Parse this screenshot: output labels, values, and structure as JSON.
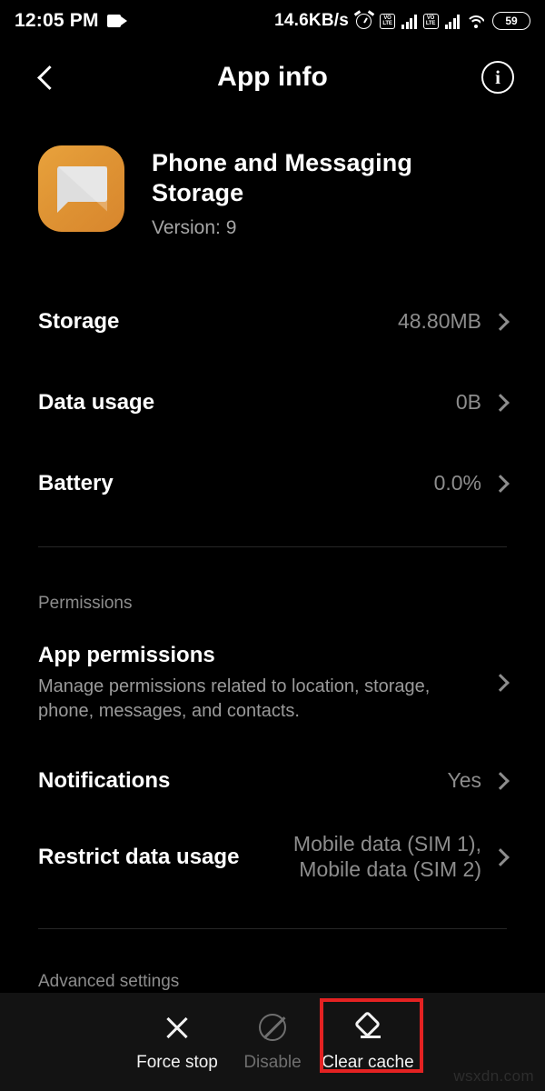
{
  "status_bar": {
    "time": "12:05 PM",
    "camera_icon": "video-camera-icon",
    "network_speed": "14.6KB/s",
    "alarm_icon": "alarm-clock-icon",
    "sim1_volte": "VoLTE",
    "sim2_volte": "VoLTE",
    "wifi_icon": "wifi-icon",
    "battery_level": "59"
  },
  "title_bar": {
    "back_icon": "back-chevron-icon",
    "title": "App info",
    "info_icon": "info-icon",
    "info_glyph": "i"
  },
  "app": {
    "icon": "message-bubble-icon",
    "name": "Phone and Messaging Storage",
    "version": "Version: 9"
  },
  "info_rows": [
    {
      "label": "Storage",
      "value": "48.80MB"
    },
    {
      "label": "Data usage",
      "value": "0B"
    },
    {
      "label": "Battery",
      "value": "0.0%"
    }
  ],
  "permissions_section": {
    "label": "Permissions",
    "app_permissions": {
      "title": "App permissions",
      "subtitle": "Manage permissions related to location, storage, phone, messages, and contacts."
    },
    "notifications": {
      "label": "Notifications",
      "value": "Yes"
    },
    "restrict_data": {
      "label": "Restrict data usage",
      "value": "Mobile data (SIM 1),\nMobile data (SIM 2)"
    }
  },
  "advanced_section": {
    "label": "Advanced settings"
  },
  "bottom_bar": [
    {
      "label": "Force stop",
      "icon": "close-x-icon",
      "disabled": false,
      "highlighted": false
    },
    {
      "label": "Disable",
      "icon": "ban-circle-icon",
      "disabled": true,
      "highlighted": false
    },
    {
      "label": "Clear cache",
      "icon": "eraser-icon",
      "disabled": false,
      "highlighted": true
    }
  ],
  "highlight_color": "#e42222",
  "accent_color": "#df9434",
  "watermark": "wsxdn.com"
}
